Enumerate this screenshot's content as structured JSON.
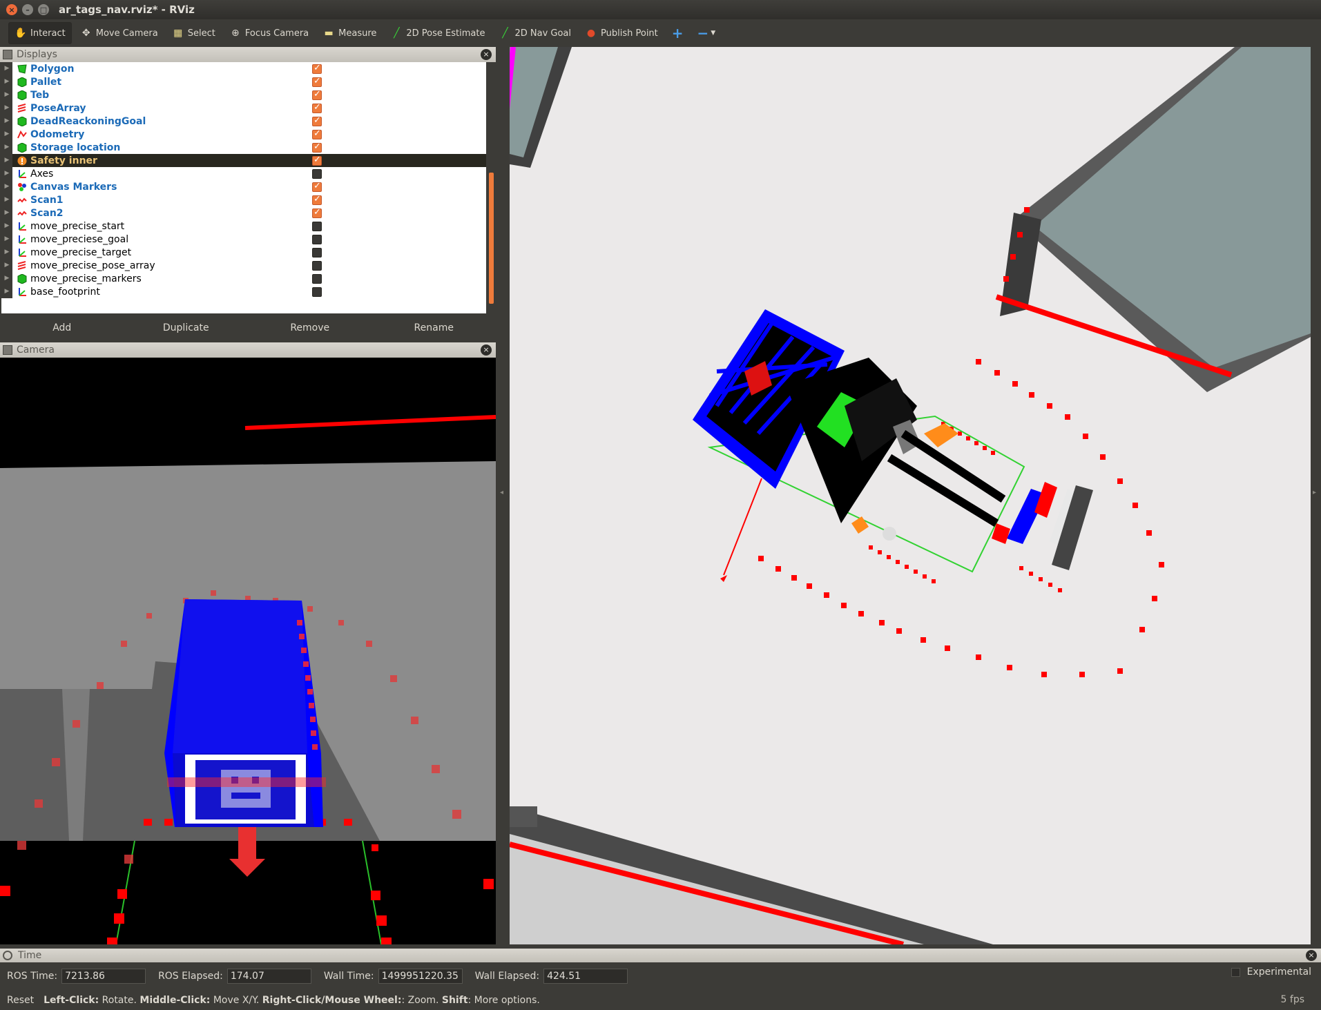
{
  "window": {
    "title": "ar_tags_nav.rviz* - RViz"
  },
  "toolbar": {
    "tools": [
      {
        "label": "Interact",
        "icon": "hand-icon"
      },
      {
        "label": "Move Camera",
        "icon": "move-icon"
      },
      {
        "label": "Select",
        "icon": "select-icon"
      },
      {
        "label": "Focus Camera",
        "icon": "crosshair-icon"
      },
      {
        "label": "Measure",
        "icon": "ruler-icon"
      },
      {
        "label": "2D Pose Estimate",
        "icon": "green-arrow-icon"
      },
      {
        "label": "2D Nav Goal",
        "icon": "green-arrow-icon"
      },
      {
        "label": "Publish Point",
        "icon": "pin-icon"
      }
    ],
    "add_glyph": "+",
    "remove_glyph": "−"
  },
  "displays": {
    "title": "Displays",
    "items": [
      {
        "label": "Polygon",
        "checked": true,
        "icon": "polygon-icon"
      },
      {
        "label": "Pallet",
        "checked": true,
        "icon": "marker-icon"
      },
      {
        "label": "Teb",
        "checked": true,
        "icon": "marker-icon"
      },
      {
        "label": "PoseArray",
        "checked": true,
        "icon": "posearray-icon"
      },
      {
        "label": "DeadReackoningGoal",
        "checked": true,
        "icon": "marker-icon"
      },
      {
        "label": "Odometry",
        "checked": true,
        "icon": "odometry-icon"
      },
      {
        "label": "Storage location",
        "checked": true,
        "icon": "marker-icon"
      },
      {
        "label": "Safety inner",
        "checked": true,
        "icon": "warning-icon"
      },
      {
        "label": "Axes",
        "checked": false,
        "icon": "axes-icon"
      },
      {
        "label": "Canvas Markers",
        "checked": true,
        "icon": "marker-array-icon"
      },
      {
        "label": "Scan1",
        "checked": true,
        "icon": "laserscan-icon"
      },
      {
        "label": "Scan2",
        "checked": true,
        "icon": "laserscan-icon"
      },
      {
        "label": "move_precise_start",
        "checked": false,
        "icon": "axes-icon"
      },
      {
        "label": "move_preciese_goal",
        "checked": false,
        "icon": "axes-icon"
      },
      {
        "label": "move_precise_target",
        "checked": false,
        "icon": "axes-icon"
      },
      {
        "label": "move_precise_pose_array",
        "checked": false,
        "icon": "posearray-icon"
      },
      {
        "label": "move_precise_markers",
        "checked": false,
        "icon": "marker-icon"
      },
      {
        "label": "base_footprint",
        "checked": false,
        "icon": "axes-icon"
      }
    ],
    "buttons": {
      "add": "Add",
      "duplicate": "Duplicate",
      "remove": "Remove",
      "rename": "Rename"
    }
  },
  "camera": {
    "title": "Camera"
  },
  "time": {
    "title": "Time",
    "ros_time_label": "ROS Time:",
    "ros_time": "7213.86",
    "ros_elapsed_label": "ROS Elapsed:",
    "ros_elapsed": "174.07",
    "wall_time_label": "Wall Time:",
    "wall_time": "1499951220.35",
    "wall_elapsed_label": "Wall Elapsed:",
    "wall_elapsed": "424.51",
    "experimental": "Experimental"
  },
  "status": {
    "reset": "Reset",
    "left_click": "Left-Click:",
    "left_click_desc": "Rotate.",
    "middle_click": "Middle-Click:",
    "middle_click_desc": "Move X/Y.",
    "right_click": "Right-Click/Mouse Wheel:",
    "right_click_desc": ": Zoom.",
    "shift": "Shift",
    "shift_desc": ": More options.",
    "fps": "5 fps"
  },
  "colors": {
    "accent": "#ef7b3b",
    "link": "#1b6ab7",
    "laser": "#ff0000",
    "robot_blue": "#0000ff"
  }
}
